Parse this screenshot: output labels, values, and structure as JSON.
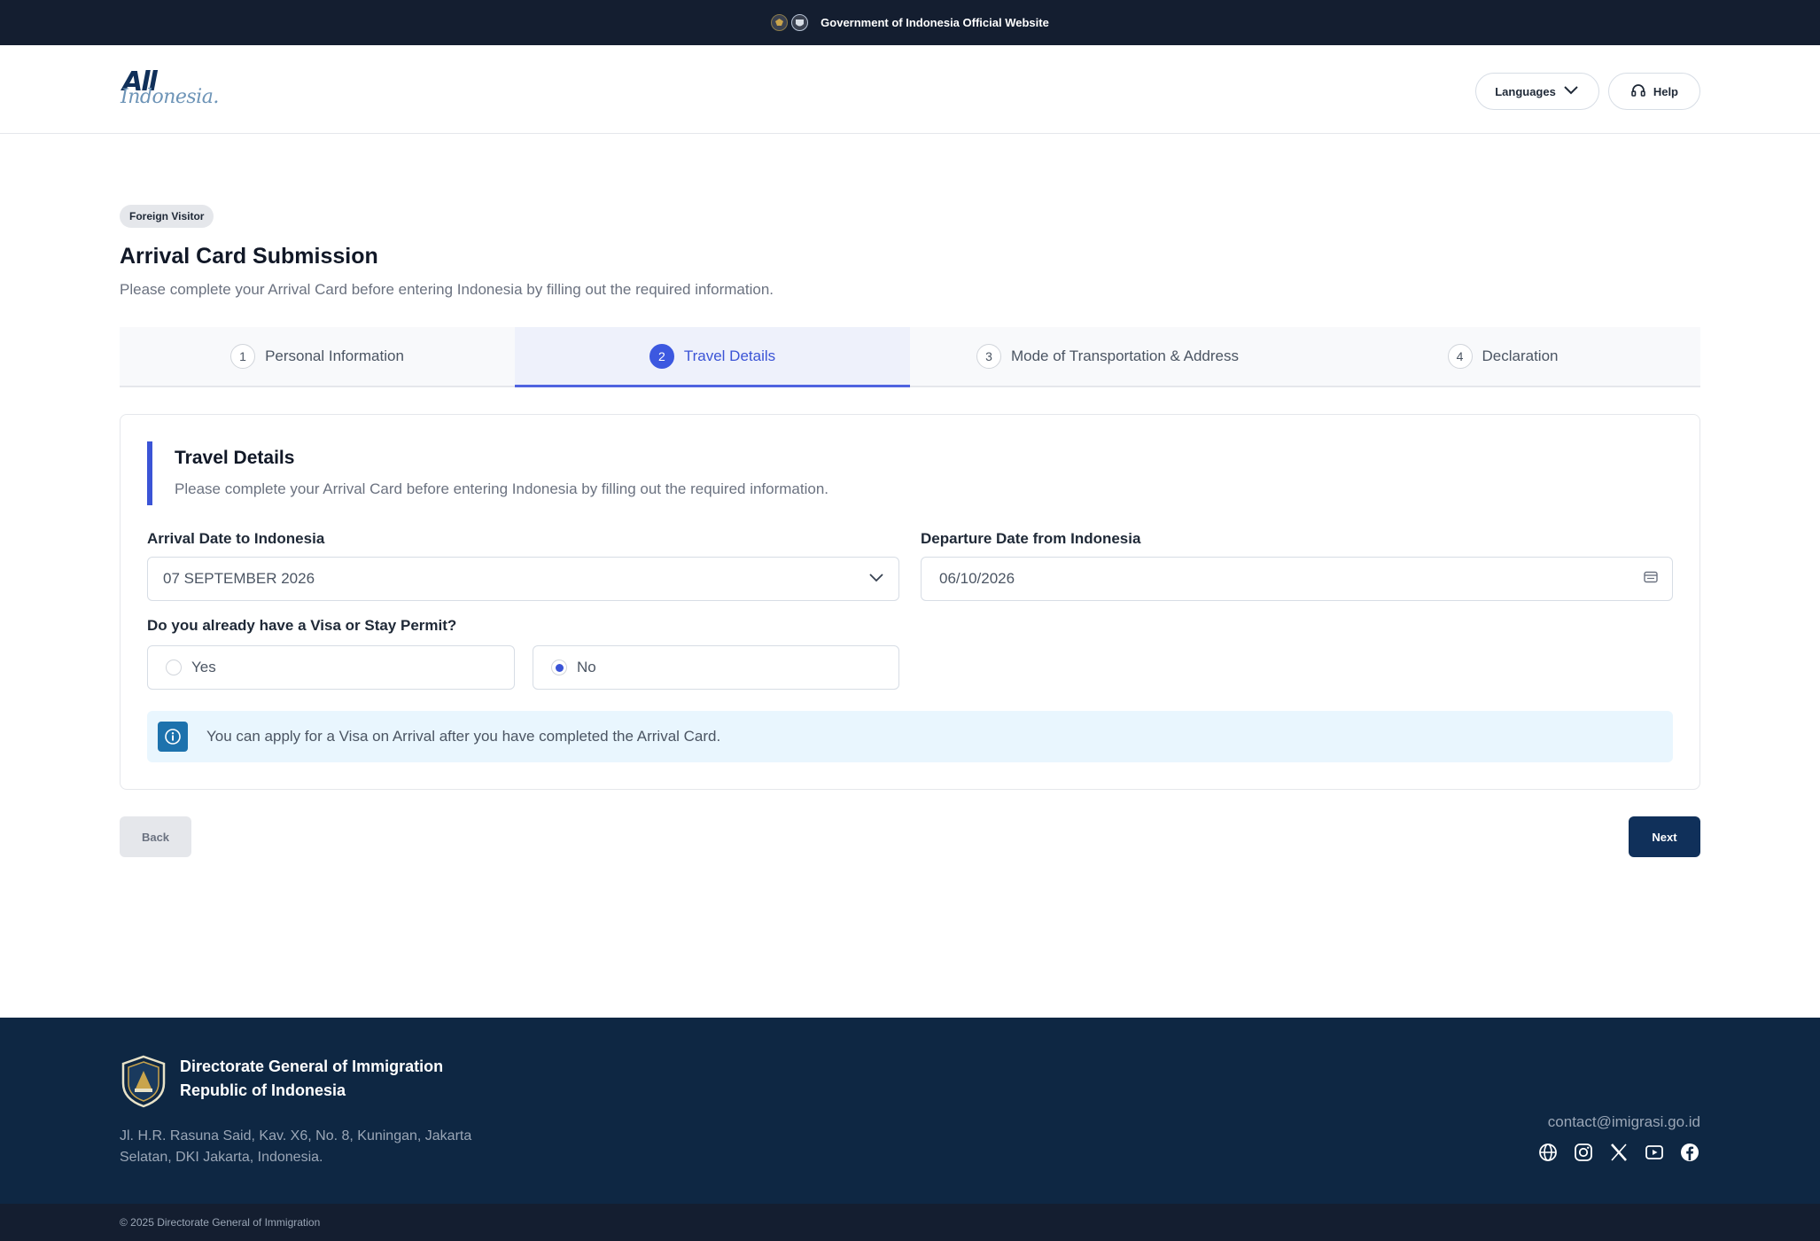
{
  "gov_bar": {
    "text": "Government of Indonesia Official Website"
  },
  "header": {
    "logo_all": "All",
    "logo_indonesia": "Indonesia.",
    "languages_label": "Languages",
    "help_label": "Help"
  },
  "page": {
    "badge": "Foreign Visitor",
    "title": "Arrival Card Submission",
    "subtitle": "Please complete your Arrival Card before entering Indonesia by filling out the required information."
  },
  "steps": [
    {
      "num": "1",
      "label": "Personal Information",
      "active": false
    },
    {
      "num": "2",
      "label": "Travel Details",
      "active": true
    },
    {
      "num": "3",
      "label": "Mode of Transportation & Address",
      "active": false
    },
    {
      "num": "4",
      "label": "Declaration",
      "active": false
    }
  ],
  "form": {
    "section_title": "Travel Details",
    "section_subtitle": "Please complete your Arrival Card before entering Indonesia by filling out the required information.",
    "arrival_label": "Arrival Date to Indonesia",
    "arrival_value": "07 SEPTEMBER 2026",
    "departure_label": "Departure Date from Indonesia",
    "departure_value": "06/10/2026",
    "visa_question": "Do you already have a Visa or Stay Permit?",
    "visa_options": [
      {
        "label": "Yes",
        "checked": false
      },
      {
        "label": "No",
        "checked": true
      }
    ],
    "info_text": "You can apply for a Visa on Arrival after you have completed the Arrival Card."
  },
  "actions": {
    "back_label": "Back",
    "next_label": "Next"
  },
  "footer": {
    "org_line1": "Directorate General of Immigration",
    "org_line2": "Republic of Indonesia",
    "address_line1": "Jl. H.R. Rasuna Said, Kav. X6, No. 8, Kuningan, Jakarta",
    "address_line2": "Selatan, DKI Jakarta, Indonesia.",
    "email": "contact@imigrasi.go.id",
    "socials": [
      "globe-icon",
      "instagram-icon",
      "x-icon",
      "youtube-icon",
      "facebook-icon"
    ],
    "copyright": "© 2025 Directorate General of Immigration"
  },
  "colors": {
    "brand_navy": "#10305a",
    "accent_blue": "#3b54d6",
    "info_bg": "#e9f6fe",
    "info_icon": "#1d72ad",
    "footer_bg": "#0e2743",
    "top_bar_bg": "#141e30"
  }
}
